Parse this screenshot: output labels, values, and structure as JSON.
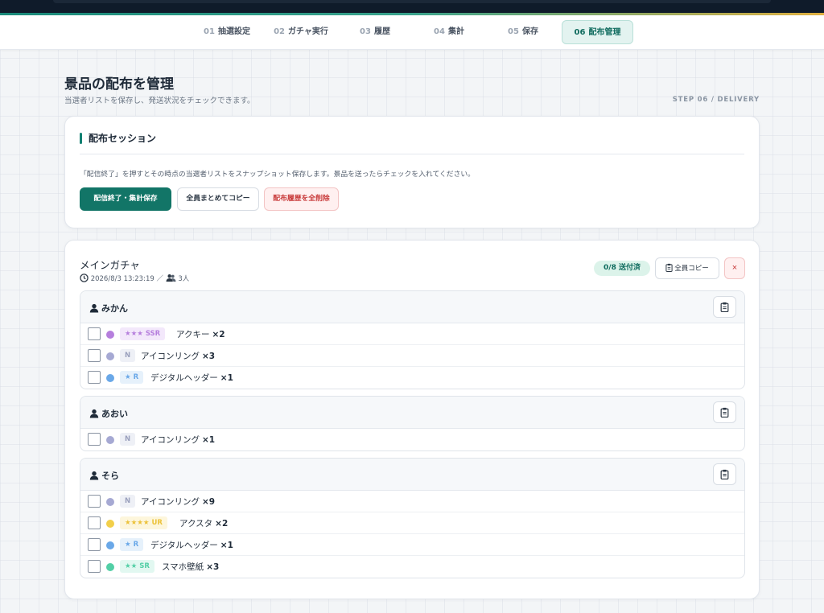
{
  "steps": [
    {
      "num": "01",
      "label": "抽選設定"
    },
    {
      "num": "02",
      "label": "ガチャ実行"
    },
    {
      "num": "03",
      "label": "履歴"
    },
    {
      "num": "04",
      "label": "集計"
    },
    {
      "num": "05",
      "label": "保存"
    },
    {
      "num": "06",
      "label": "配布管理",
      "active": true
    }
  ],
  "page": {
    "title": "景品の配布を管理",
    "subtitle": "当選者リストを保存し、発送状況をチェックできます。",
    "step_tag": "STEP 06 / DELIVERY"
  },
  "session_card": {
    "title": "配布セッション",
    "description": "「配信終了」を押すとその時点の当選者リストをスナップショット保存します。景品を送ったらチェックを入れてください。",
    "end_button": "配信終了・集計保存",
    "copy_button": "全員まとめてコピー",
    "delete_button": "配布履歴を全削除"
  },
  "session": {
    "name": "メインガチャ",
    "datetime": "2026/8/3 13:23:19",
    "separator": "／",
    "people": "3人",
    "sent_badge": "0/8 送付済",
    "copy_all": "全員コピー",
    "close": "×"
  },
  "rarity_colors": {
    "SSR": "#b67fdd",
    "N": "#a6a9d3",
    "R": "#6aa8e8",
    "UR": "#f2cf4a",
    "SR": "#53cfa6"
  },
  "users": [
    {
      "name": "みかん",
      "items": [
        {
          "rarity": "SSR",
          "badge": "★★★ SSR",
          "name": "アクキー",
          "qty": "×2",
          "checked": false
        },
        {
          "rarity": "N",
          "badge": "N",
          "name": "アイコンリング",
          "qty": "×3",
          "checked": false
        },
        {
          "rarity": "R",
          "badge": "★ R",
          "name": "デジタルヘッダー",
          "qty": "×1",
          "checked": false
        }
      ]
    },
    {
      "name": "あおい",
      "items": [
        {
          "rarity": "N",
          "badge": "N",
          "name": "アイコンリング",
          "qty": "×1",
          "checked": false
        }
      ]
    },
    {
      "name": "そら",
      "items": [
        {
          "rarity": "N",
          "badge": "N",
          "name": "アイコンリング",
          "qty": "×9",
          "checked": false
        },
        {
          "rarity": "UR",
          "badge": "★★★★ UR",
          "name": "アクスタ",
          "qty": "×2",
          "checked": false
        },
        {
          "rarity": "R",
          "badge": "★ R",
          "name": "デジタルヘッダー",
          "qty": "×1",
          "checked": false
        },
        {
          "rarity": "SR",
          "badge": "★★ SR",
          "name": "スマホ壁紙",
          "qty": "×3",
          "checked": false
        }
      ]
    }
  ]
}
